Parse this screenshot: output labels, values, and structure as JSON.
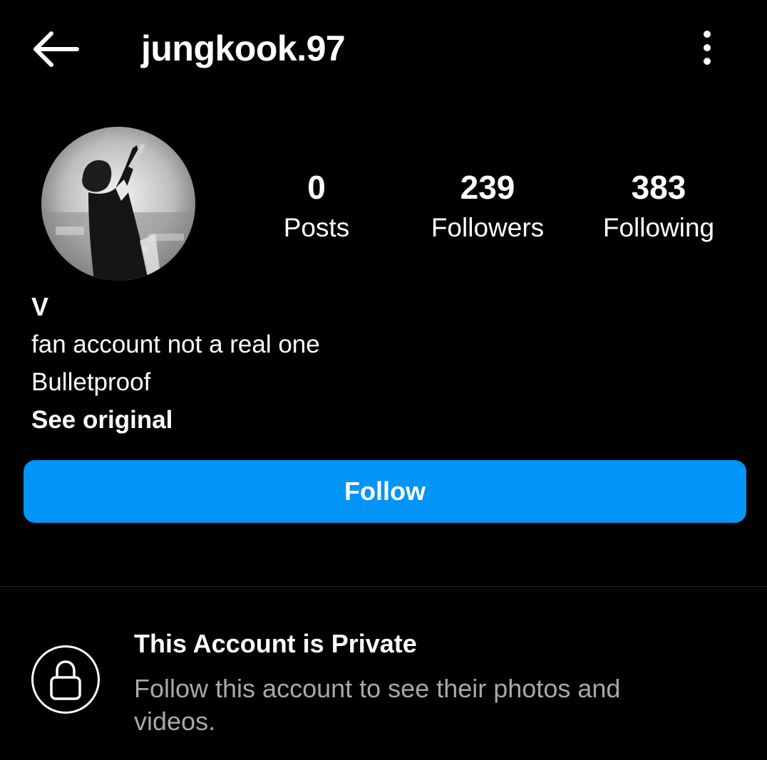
{
  "header": {
    "back_icon": "arrow-left-icon",
    "username": "jungkook.97",
    "more_icon": "more-vertical-icon"
  },
  "profile": {
    "avatar_icon": "profile-photo",
    "stats": {
      "posts": {
        "value": "0",
        "label": "Posts"
      },
      "followers": {
        "value": "239",
        "label": "Followers"
      },
      "following": {
        "value": "383",
        "label": "Following"
      }
    }
  },
  "bio": {
    "name": "V",
    "line1": "fan account not a real one",
    "line2": "Bulletproof",
    "see_original": "See original"
  },
  "actions": {
    "follow_label": "Follow"
  },
  "private_notice": {
    "icon": "lock-icon",
    "title": "This Account is Private",
    "description": "Follow this account to see their photos and videos."
  },
  "colors": {
    "background": "#000000",
    "accent": "#0095f6",
    "text": "#ffffff",
    "muted_text": "#a8a8a8",
    "divider": "#262626"
  }
}
